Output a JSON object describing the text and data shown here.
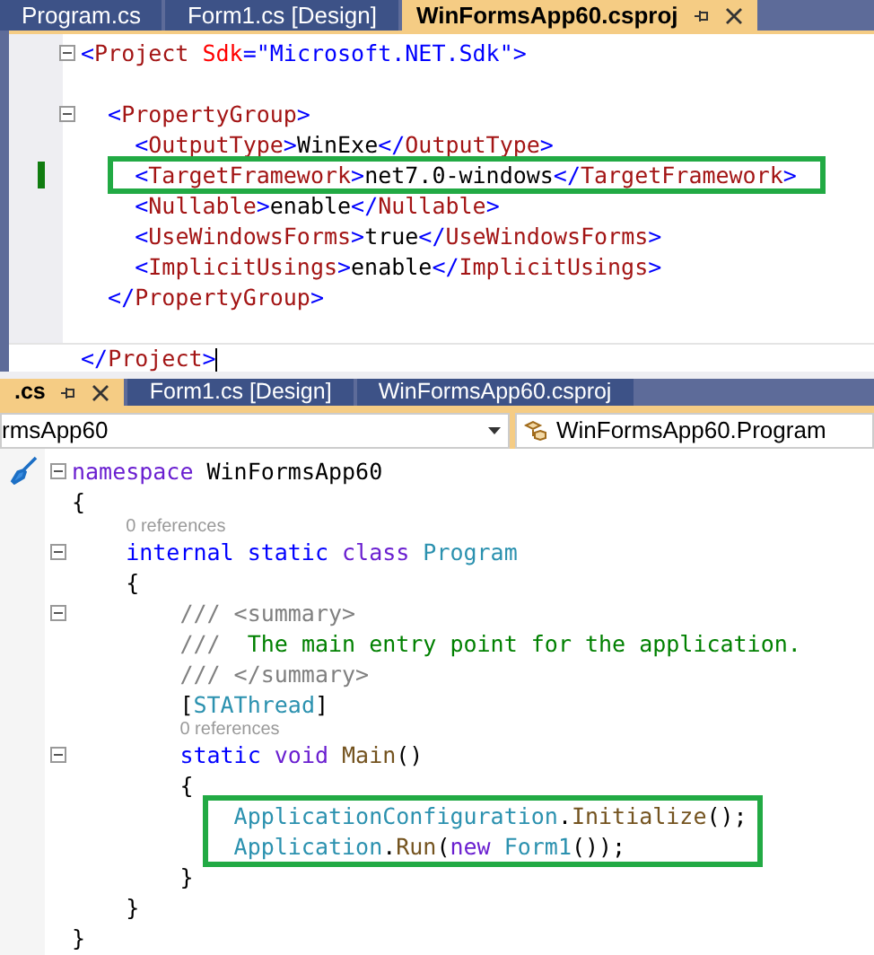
{
  "top_pane": {
    "tabs": [
      {
        "label": "Program.cs",
        "selected": false
      },
      {
        "label": "Form1.cs [Design]",
        "selected": false
      },
      {
        "label": "WinFormsApp60.csproj",
        "selected": true
      }
    ],
    "lines": [
      {
        "kind": "code",
        "fold": true,
        "tokens": [
          {
            "kind": "punct",
            "text": "<"
          },
          {
            "kind": "element",
            "text": "Project "
          },
          {
            "kind": "attr",
            "text": "Sdk"
          },
          {
            "kind": "punct",
            "text": "=\""
          },
          {
            "kind": "string",
            "text": "Microsoft.NET.Sdk"
          },
          {
            "kind": "punct",
            "text": "\">"
          }
        ]
      },
      {
        "kind": "blank"
      },
      {
        "kind": "code",
        "fold": true,
        "tokens": [
          {
            "kind": "punct",
            "text": "  <"
          },
          {
            "kind": "element",
            "text": "PropertyGroup"
          },
          {
            "kind": "punct",
            "text": ">"
          }
        ]
      },
      {
        "kind": "code",
        "tokens": [
          {
            "kind": "punct",
            "text": "    <"
          },
          {
            "kind": "element",
            "text": "OutputType"
          },
          {
            "kind": "punct",
            "text": ">"
          },
          {
            "kind": "plain",
            "text": "WinExe"
          },
          {
            "kind": "punct",
            "text": "</"
          },
          {
            "kind": "element",
            "text": "OutputType"
          },
          {
            "kind": "punct",
            "text": ">"
          }
        ]
      },
      {
        "kind": "code",
        "changed": true,
        "boxed": true,
        "tokens": [
          {
            "kind": "punct",
            "text": "    <"
          },
          {
            "kind": "element",
            "text": "TargetFramework"
          },
          {
            "kind": "punct",
            "text": ">"
          },
          {
            "kind": "plain",
            "text": "net7.0-windows"
          },
          {
            "kind": "punct",
            "text": "</"
          },
          {
            "kind": "element",
            "text": "TargetFramework"
          },
          {
            "kind": "punct",
            "text": ">"
          }
        ]
      },
      {
        "kind": "code",
        "tokens": [
          {
            "kind": "punct",
            "text": "    <"
          },
          {
            "kind": "element",
            "text": "Nullable"
          },
          {
            "kind": "punct",
            "text": ">"
          },
          {
            "kind": "plain",
            "text": "enable"
          },
          {
            "kind": "punct",
            "text": "</"
          },
          {
            "kind": "element",
            "text": "Nullable"
          },
          {
            "kind": "punct",
            "text": ">"
          }
        ]
      },
      {
        "kind": "code",
        "tokens": [
          {
            "kind": "punct",
            "text": "    <"
          },
          {
            "kind": "element",
            "text": "UseWindowsForms"
          },
          {
            "kind": "punct",
            "text": ">"
          },
          {
            "kind": "plain",
            "text": "true"
          },
          {
            "kind": "punct",
            "text": "</"
          },
          {
            "kind": "element",
            "text": "UseWindowsForms"
          },
          {
            "kind": "punct",
            "text": ">"
          }
        ]
      },
      {
        "kind": "code",
        "tokens": [
          {
            "kind": "punct",
            "text": "    <"
          },
          {
            "kind": "element",
            "text": "ImplicitUsings"
          },
          {
            "kind": "punct",
            "text": ">"
          },
          {
            "kind": "plain",
            "text": "enable"
          },
          {
            "kind": "punct",
            "text": "</"
          },
          {
            "kind": "element",
            "text": "ImplicitUsings"
          },
          {
            "kind": "punct",
            "text": ">"
          }
        ]
      },
      {
        "kind": "code",
        "tokens": [
          {
            "kind": "punct",
            "text": "  </"
          },
          {
            "kind": "element",
            "text": "PropertyGroup"
          },
          {
            "kind": "punct",
            "text": ">"
          }
        ]
      },
      {
        "kind": "blank"
      },
      {
        "kind": "code",
        "current": true,
        "tokens": [
          {
            "kind": "punct",
            "text": "</"
          },
          {
            "kind": "element",
            "text": "Project"
          },
          {
            "kind": "punct",
            "text": ">"
          }
        ]
      }
    ]
  },
  "bottom_pane": {
    "tabs": [
      {
        "label": ".cs",
        "selected": true
      },
      {
        "label": "Form1.cs [Design]",
        "selected": false
      },
      {
        "label": "WinFormsApp60.csproj",
        "selected": false
      }
    ],
    "nav": {
      "project": "rmsApp60",
      "member": "WinFormsApp60.Program"
    },
    "lines": [
      {
        "kind": "code",
        "fold": true,
        "tokens": [
          {
            "kind": "keyword2",
            "text": "namespace"
          },
          {
            "kind": "plain",
            "text": " WinFormsApp60"
          }
        ]
      },
      {
        "kind": "code",
        "tokens": [
          {
            "kind": "plain",
            "text": "{"
          }
        ]
      },
      {
        "kind": "codelens",
        "text": "0 references"
      },
      {
        "kind": "code",
        "fold": true,
        "tokens": [
          {
            "kind": "keyword",
            "text": "    internal static "
          },
          {
            "kind": "keyword2",
            "text": "class "
          },
          {
            "kind": "type",
            "text": "Program"
          }
        ]
      },
      {
        "kind": "code",
        "tokens": [
          {
            "kind": "plain",
            "text": "    {"
          }
        ]
      },
      {
        "kind": "code",
        "fold": true,
        "tokens": [
          {
            "kind": "doc",
            "text": "        /// <summary>"
          }
        ]
      },
      {
        "kind": "code",
        "tokens": [
          {
            "kind": "doc",
            "text": "        ///"
          },
          {
            "kind": "comment",
            "text": "  The main entry point for the application."
          }
        ]
      },
      {
        "kind": "code",
        "tokens": [
          {
            "kind": "doc",
            "text": "        /// </summary>"
          }
        ]
      },
      {
        "kind": "code",
        "tokens": [
          {
            "kind": "plain",
            "text": "        ["
          },
          {
            "kind": "type",
            "text": "STAThread"
          },
          {
            "kind": "plain",
            "text": "]"
          }
        ]
      },
      {
        "kind": "codelens",
        "text": "0 references"
      },
      {
        "kind": "code",
        "fold": true,
        "tokens": [
          {
            "kind": "keyword",
            "text": "        static "
          },
          {
            "kind": "keyword2",
            "text": "void "
          },
          {
            "kind": "method",
            "text": "Main"
          },
          {
            "kind": "plain",
            "text": "()"
          }
        ]
      },
      {
        "kind": "code",
        "tokens": [
          {
            "kind": "plain",
            "text": "        {"
          }
        ]
      },
      {
        "kind": "code",
        "boxed": true,
        "tokens": [
          {
            "kind": "type",
            "text": "            ApplicationConfiguration"
          },
          {
            "kind": "plain",
            "text": "."
          },
          {
            "kind": "method",
            "text": "Initialize"
          },
          {
            "kind": "plain",
            "text": "();"
          }
        ]
      },
      {
        "kind": "code",
        "boxed": true,
        "tokens": [
          {
            "kind": "type",
            "text": "            Application"
          },
          {
            "kind": "plain",
            "text": "."
          },
          {
            "kind": "method",
            "text": "Run"
          },
          {
            "kind": "plain",
            "text": "("
          },
          {
            "kind": "keyword2",
            "text": "new "
          },
          {
            "kind": "type",
            "text": "Form1"
          },
          {
            "kind": "plain",
            "text": "());"
          }
        ]
      },
      {
        "kind": "code",
        "tokens": [
          {
            "kind": "plain",
            "text": "        }"
          }
        ]
      },
      {
        "kind": "code",
        "tokens": [
          {
            "kind": "plain",
            "text": "    }"
          }
        ]
      },
      {
        "kind": "code",
        "tokens": [
          {
            "kind": "plain",
            "text": "}"
          }
        ]
      }
    ]
  }
}
